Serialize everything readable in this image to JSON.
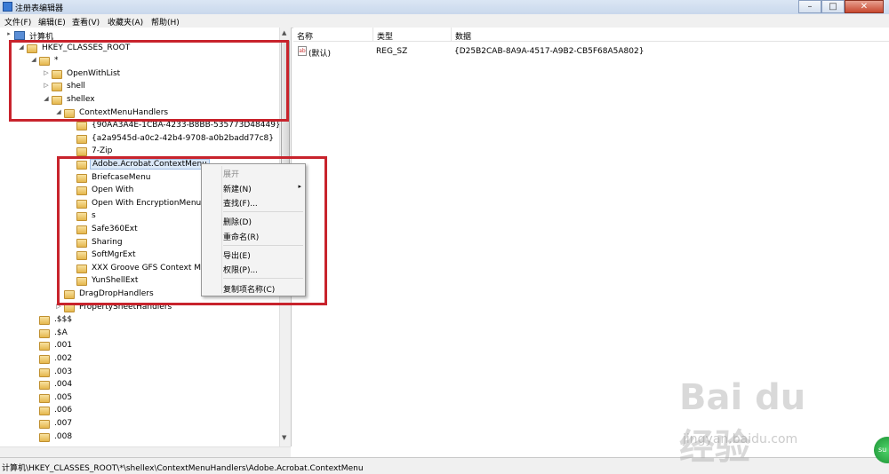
{
  "window": {
    "title": "注册表编辑器"
  },
  "menubar": [
    "文件(F)",
    "编辑(E)",
    "查看(V)",
    "收藏夹(A)",
    "帮助(H)"
  ],
  "tree": [
    {
      "label": "计算机",
      "expander": "▸",
      "icon": "computer"
    },
    {
      "label": "HKEY_CLASSES_ROOT",
      "expander": "◢",
      "icon": "folder"
    },
    {
      "label": "*",
      "expander": "◢",
      "icon": "folder"
    },
    {
      "label": "OpenWithList",
      "expander": "▷",
      "icon": "folder"
    },
    {
      "label": "shell",
      "expander": "▷",
      "icon": "folder"
    },
    {
      "label": "shellex",
      "expander": "◢",
      "icon": "folder"
    },
    {
      "label": "ContextMenuHandlers",
      "expander": "◢",
      "icon": "folder"
    },
    {
      "label": "{90AA3A4E-1CBA-4233-B8BB-535773D48449}",
      "expander": "",
      "icon": "folder"
    },
    {
      "label": "{a2a9545d-a0c2-42b4-9708-a0b2badd77c8}",
      "expander": "",
      "icon": "folder"
    },
    {
      "label": "7-Zip",
      "expander": "",
      "icon": "folder"
    },
    {
      "label": "Adobe.Acrobat.ContextMenu",
      "expander": "",
      "icon": "folder",
      "selected": true
    },
    {
      "label": "BriefcaseMenu",
      "expander": "",
      "icon": "folder"
    },
    {
      "label": "Open With",
      "expander": "",
      "icon": "folder"
    },
    {
      "label": "Open With EncryptionMenu",
      "expander": "",
      "icon": "folder"
    },
    {
      "label": "s",
      "expander": "",
      "icon": "folder"
    },
    {
      "label": "Safe360Ext",
      "expander": "",
      "icon": "folder"
    },
    {
      "label": "Sharing",
      "expander": "",
      "icon": "folder"
    },
    {
      "label": "SoftMgrExt",
      "expander": "",
      "icon": "folder"
    },
    {
      "label": "XXX Groove GFS Context Me",
      "expander": "",
      "icon": "folder"
    },
    {
      "label": "YunShellExt",
      "expander": "",
      "icon": "folder"
    },
    {
      "label": "DragDropHandlers",
      "expander": "",
      "icon": "folder"
    },
    {
      "label": "PropertySheetHandlers",
      "expander": "▷",
      "icon": "folder"
    },
    {
      "label": ".$$$",
      "expander": "",
      "icon": "folder"
    },
    {
      "label": ".$A",
      "expander": "",
      "icon": "folder"
    },
    {
      "label": ".001",
      "expander": "",
      "icon": "folder"
    },
    {
      "label": ".002",
      "expander": "",
      "icon": "folder"
    },
    {
      "label": ".003",
      "expander": "",
      "icon": "folder"
    },
    {
      "label": ".004",
      "expander": "",
      "icon": "folder"
    },
    {
      "label": ".005",
      "expander": "",
      "icon": "folder"
    },
    {
      "label": ".006",
      "expander": "",
      "icon": "folder"
    },
    {
      "label": ".007",
      "expander": "",
      "icon": "folder"
    },
    {
      "label": ".008",
      "expander": "",
      "icon": "folder"
    }
  ],
  "list": {
    "columns": [
      "名称",
      "类型",
      "数据"
    ],
    "rows": [
      {
        "name": "(默认)",
        "type": "REG_SZ",
        "data": "{D25B2CAB-8A9A-4517-A9B2-CB5F68A5A802}",
        "icon": "string-value-icon"
      }
    ]
  },
  "context_menu": {
    "items": [
      {
        "label": "展开",
        "disabled": true
      },
      {
        "label": "新建(N)",
        "submenu": "▸"
      },
      {
        "label": "查找(F)..."
      },
      {
        "label": "删除(D)"
      },
      {
        "label": "重命名(R)"
      },
      {
        "label": "导出(E)"
      },
      {
        "label": "权限(P)..."
      },
      {
        "label": "复制项名称(C)"
      }
    ]
  },
  "statusbar": {
    "path": "计算机\\HKEY_CLASSES_ROOT\\*\\shellex\\ContextMenuHandlers\\Adobe.Acrobat.ContextMenu"
  },
  "watermark": {
    "logo": "Bai du 经验",
    "site": "jingyan.baidu.com"
  },
  "badge": {
    "text": "su"
  },
  "colors": {
    "highlight_box": "#c8232c",
    "selection": "#dbe8f8"
  }
}
